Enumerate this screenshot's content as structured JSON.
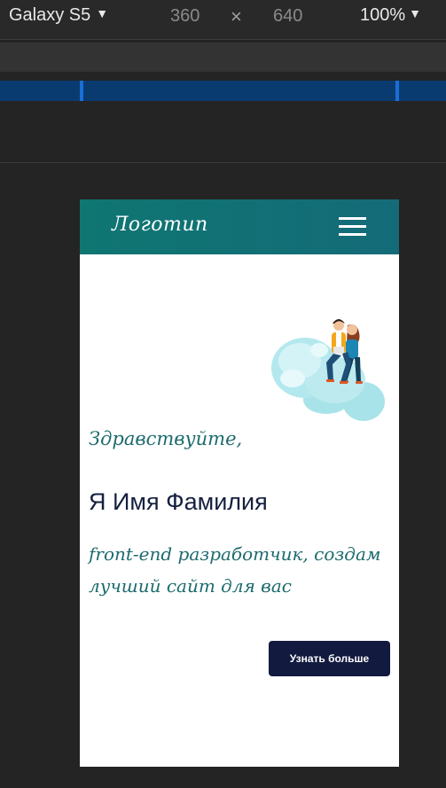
{
  "devtools": {
    "device_name": "Galaxy S5",
    "width": "360",
    "times": "×",
    "height": "640",
    "zoom": "100%"
  },
  "site": {
    "logo": "Логотип",
    "greeting": "Здравствуйте,",
    "name": "Я Имя Фамилия",
    "role": "front-end разработчик, создам лучший сайт для вас",
    "cta_label": "Узнать больше"
  },
  "colors": {
    "header": "#0f7672",
    "accent_text": "#1d6b6e",
    "button": "#121a3f"
  }
}
